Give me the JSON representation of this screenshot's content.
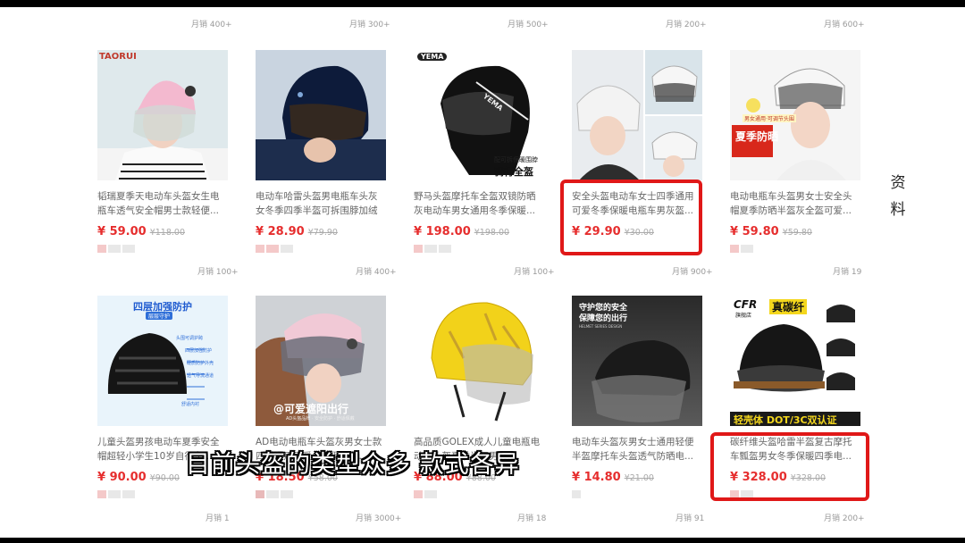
{
  "top_sales": [
    "月销 400+",
    "月销 300+",
    "月销 500+",
    "月销 200+",
    "月销 600+"
  ],
  "row1": [
    {
      "title": "韬瑞夏季天电动车头盔女生电瓶车透气安全帽男士款轻便...",
      "price": "¥ 59.00",
      "orig": "¥118.00",
      "brand": "TAORUI"
    },
    {
      "title": "电动车哈雷头盔男电瓶车头灰女冬季四季半盔可拆围脖加绒",
      "price": "¥ 28.90",
      "orig": "¥79.90",
      "brand": ""
    },
    {
      "title": "野马头盔摩托车全盔双镜防晒灰电动车男女通用冬季保暖...",
      "price": "¥ 198.00",
      "orig": "¥198.00",
      "brand": "YEMA",
      "tag1": "配可拆保暖围脖",
      "tag2": "骑行全盔",
      "visor_text": "YEMA"
    },
    {
      "title": "安全头盔电动车女士四季通用可爱冬季保暖电瓶车男灰盔...",
      "price": "¥ 29.90",
      "orig": "¥30.00",
      "brand": ""
    },
    {
      "title": "电动电瓶车头盔男女士安全头帽夏季防晒半盔灰全盔可爱...",
      "price": "¥ 59.80",
      "orig": "¥59.80",
      "brand": "",
      "tag1": "夏季防晒",
      "tag2": "男女通用·可调节头围"
    }
  ],
  "mid_sales": [
    "月销 100+",
    "月销 400+",
    "月销 100+",
    "月销 900+",
    "月销 19"
  ],
  "row2": [
    {
      "title": "儿童头盔男孩电动车夏季安全帽超轻小学生10岁自行车...",
      "price": "¥ 90.00",
      "orig": "¥90.00",
      "brand": "",
      "tag1": "四层加强防护",
      "tag2": "层层守护",
      "callouts": [
        "头围可调护跨",
        "四层加强防护",
        "硬质防护外壳",
        "透气导流通道",
        "舒适内衬"
      ]
    },
    {
      "title": "AD电动电瓶车头盔灰男女士款四季通用可爱冬季保暖头...",
      "price": "¥ 18.50",
      "orig": "¥58.00",
      "brand": "",
      "tag1": "@可爱遮阳出行",
      "tag2": "AD头盔品牌 · 安全防护 · 舒适佩戴"
    },
    {
      "title": "高品质GOLEX成人儿童电瓶电动车头盔夏季半盔男女...",
      "price": "¥ 88.00",
      "orig": "¥88.00",
      "brand": ""
    },
    {
      "title": "电动车头盔灰男女士通用轻便半盔摩托车头盔透气防晒电...",
      "price": "¥ 14.80",
      "orig": "¥21.00",
      "brand": "",
      "tag1": "守护您的安全",
      "tag2": "保障您的出行",
      "tag3": "HELMET SERIES DESIGN"
    },
    {
      "title": "碳纤维头盔哈雷半盔复古摩托车瓢盔男女冬季保暖四季电...",
      "price": "¥ 328.00",
      "orig": "¥328.00",
      "brand": "CFR",
      "brand_sub": "旗舰店",
      "tag1": "真碳纤",
      "tag2": "轻壳体 DOT/3C双认证"
    }
  ],
  "bottom_sales": [
    "月销 1",
    "月销 3000+",
    "月销 18",
    "月销 91",
    "月销 200+"
  ],
  "side_note": "资料",
  "caption": "目前头盔的类型众多  款式各异",
  "colors": {
    "price": "#e62e2e",
    "highlight": "#e01818"
  }
}
